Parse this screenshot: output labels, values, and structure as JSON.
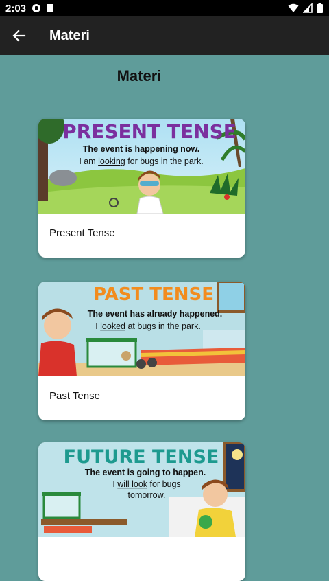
{
  "status_bar": {
    "time": "2:03"
  },
  "app_bar": {
    "title": "Materi"
  },
  "page": {
    "heading": "Materi"
  },
  "cards": [
    {
      "banner_title": "PRESENT TENSE",
      "banner_line1": "The event is happening now.",
      "banner_line2_pre": "I am ",
      "banner_line2_em": "looking",
      "banner_line2_post": " for bugs in the park.",
      "caption": "Present Tense",
      "title_color": "#7b2f9e"
    },
    {
      "banner_title": "PAST TENSE",
      "banner_line1": "The event has already happened.",
      "banner_line2_pre": "I ",
      "banner_line2_em": "looked",
      "banner_line2_post": " at bugs in the park.",
      "caption": "Past Tense",
      "title_color": "#f28c1e"
    },
    {
      "banner_title": "FUTURE TENSE",
      "banner_line1": "The event is going to happen.",
      "banner_line2_pre": "I ",
      "banner_line2_em": "will look",
      "banner_line2_post": " for bugs",
      "banner_line3": "tomorrow.",
      "caption": "",
      "title_color": "#1d9a8f"
    }
  ],
  "colors": {
    "background": "#5f9c9a",
    "app_bar": "#222222",
    "status_bar": "#000000"
  },
  "icons": {
    "back": "arrow-left-icon",
    "wifi": "wifi-icon",
    "signal": "signal-icon",
    "battery": "battery-icon"
  }
}
